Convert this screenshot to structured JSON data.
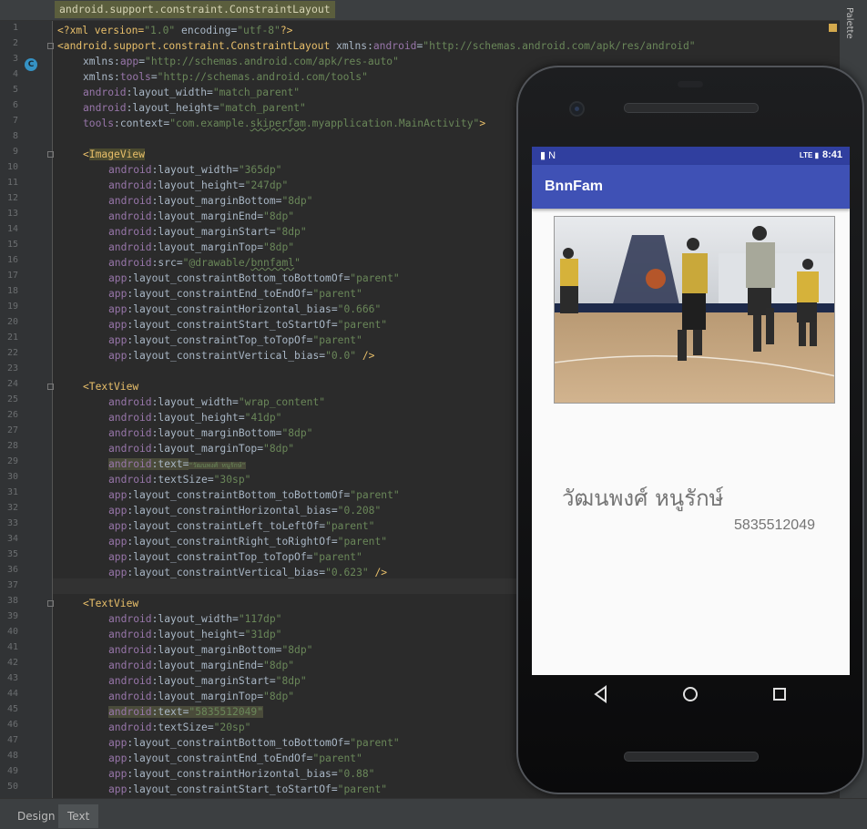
{
  "breadcrumb": "android.support.constraint.ConstraintLayout",
  "line_numbers": [
    "1",
    "2",
    "3",
    "4",
    "5",
    "6",
    "7",
    "8",
    "9",
    "10",
    "11",
    "12",
    "13",
    "14",
    "15",
    "16",
    "17",
    "18",
    "19",
    "20",
    "21",
    "22",
    "23",
    "24",
    "25",
    "26",
    "27",
    "28",
    "29",
    "30",
    "31",
    "32",
    "33",
    "34",
    "35",
    "36",
    "37",
    "38",
    "39",
    "40",
    "41",
    "42",
    "43",
    "44",
    "45",
    "46",
    "47",
    "48",
    "49",
    "50"
  ],
  "palette_tab": "Palette",
  "bottom_tabs": {
    "design": "Design",
    "text": "Text"
  },
  "gutter_badge": "C",
  "phone": {
    "status_time": "8:41",
    "status_left_icons": "▮ N",
    "status_right_icons": "LTE ▮",
    "app_title": "BnnFam",
    "name_text": "วัฒนพงศ์ หนูรักษ์",
    "id_text": "5835512049",
    "nav": [
      "back-icon",
      "home-icon",
      "recents-icon"
    ]
  },
  "code": {
    "l1": {
      "a": "<?xml version=",
      "b": "\"1.0\"",
      "c": " encoding=",
      "d": "\"utf-8\"",
      "e": "?>"
    },
    "l2": {
      "a": "<android.support.constraint.ConstraintLayout",
      "b": " xmlns:",
      "c": "android",
      "d": "=",
      "e": "\"http://schemas.android.com/apk/res/android\""
    },
    "l3": {
      "a": "xmlns:",
      "b": "app",
      "c": "=",
      "d": "\"http://schemas.android.com/apk/res-auto\""
    },
    "l4": {
      "a": "xmlns:",
      "b": "tools",
      "c": "=",
      "d": "\"http://schemas.android.com/tools\""
    },
    "l5": {
      "a": "android",
      "b": ":layout_width=",
      "c": "\"match_parent\""
    },
    "l6": {
      "a": "android",
      "b": ":layout_height=",
      "c": "\"match_parent\""
    },
    "l7": {
      "a": "tools",
      "b": ":context=",
      "c": "\"com.example.",
      "d": "skiperfam",
      "e": ".myapplication.MainActivity\"",
      "f": ">"
    },
    "l9": {
      "a": "<",
      "b": "ImageView"
    },
    "l10": {
      "a": "android",
      "b": ":layout_width=",
      "c": "\"365dp\""
    },
    "l11": {
      "a": "android",
      "b": ":layout_height=",
      "c": "\"247dp\""
    },
    "l12": {
      "a": "android",
      "b": ":layout_marginBottom=",
      "c": "\"8dp\""
    },
    "l13": {
      "a": "android",
      "b": ":layout_marginEnd=",
      "c": "\"8dp\""
    },
    "l14": {
      "a": "android",
      "b": ":layout_marginStart=",
      "c": "\"8dp\""
    },
    "l15": {
      "a": "android",
      "b": ":layout_marginTop=",
      "c": "\"8dp\""
    },
    "l16": {
      "a": "android",
      "b": ":src=",
      "c": "\"@drawable/",
      "d": "bnnfaml",
      "e": "\""
    },
    "l17": {
      "a": "app",
      "b": ":layout_constraintBottom_toBottomOf=",
      "c": "\"parent\""
    },
    "l18": {
      "a": "app",
      "b": ":layout_constraintEnd_toEndOf=",
      "c": "\"parent\""
    },
    "l19": {
      "a": "app",
      "b": ":layout_constraintHorizontal_bias=",
      "c": "\"0.666\""
    },
    "l20": {
      "a": "app",
      "b": ":layout_constraintStart_toStartOf=",
      "c": "\"parent\""
    },
    "l21": {
      "a": "app",
      "b": ":layout_constraintTop_toTopOf=",
      "c": "\"parent\""
    },
    "l22": {
      "a": "app",
      "b": ":layout_constraintVertical_bias=",
      "c": "\"0.0\"",
      "d": " />"
    },
    "l24": {
      "a": "<TextView"
    },
    "l25": {
      "a": "android",
      "b": ":layout_width=",
      "c": "\"wrap_content\""
    },
    "l26": {
      "a": "android",
      "b": ":layout_height=",
      "c": "\"41dp\""
    },
    "l27": {
      "a": "android",
      "b": ":layout_marginBottom=",
      "c": "\"8dp\""
    },
    "l28": {
      "a": "android",
      "b": ":layout_marginTop=",
      "c": "\"8dp\""
    },
    "l29": {
      "a": "android",
      "b": ":text=",
      "c": "\"วัฒนพงศ์ หนูรักษ์\""
    },
    "l30": {
      "a": "android",
      "b": ":textSize=",
      "c": "\"30sp\""
    },
    "l31": {
      "a": "app",
      "b": ":layout_constraintBottom_toBottomOf=",
      "c": "\"parent\""
    },
    "l32": {
      "a": "app",
      "b": ":layout_constraintHorizontal_bias=",
      "c": "\"0.208\""
    },
    "l33": {
      "a": "app",
      "b": ":layout_constraintLeft_toLeftOf=",
      "c": "\"parent\""
    },
    "l34": {
      "a": "app",
      "b": ":layout_constraintRight_toRightOf=",
      "c": "\"parent\""
    },
    "l35": {
      "a": "app",
      "b": ":layout_constraintTop_toTopOf=",
      "c": "\"parent\""
    },
    "l36": {
      "a": "app",
      "b": ":layout_constraintVertical_bias=",
      "c": "\"0.623\"",
      "d": " />"
    },
    "l38": {
      "a": "<TextView"
    },
    "l39": {
      "a": "android",
      "b": ":layout_width=",
      "c": "\"117dp\""
    },
    "l40": {
      "a": "android",
      "b": ":layout_height=",
      "c": "\"31dp\""
    },
    "l41": {
      "a": "android",
      "b": ":layout_marginBottom=",
      "c": "\"8dp\""
    },
    "l42": {
      "a": "android",
      "b": ":layout_marginEnd=",
      "c": "\"8dp\""
    },
    "l43": {
      "a": "android",
      "b": ":layout_marginStart=",
      "c": "\"8dp\""
    },
    "l44": {
      "a": "android",
      "b": ":layout_marginTop=",
      "c": "\"8dp\""
    },
    "l45": {
      "a": "android",
      "b": ":text=",
      "c": "\"5835512049\""
    },
    "l46": {
      "a": "android",
      "b": ":textSize=",
      "c": "\"20sp\""
    },
    "l47": {
      "a": "app",
      "b": ":layout_constraintBottom_toBottomOf=",
      "c": "\"parent\""
    },
    "l48": {
      "a": "app",
      "b": ":layout_constraintEnd_toEndOf=",
      "c": "\"parent\""
    },
    "l49": {
      "a": "app",
      "b": ":layout_constraintHorizontal_bias=",
      "c": "\"0.88\""
    },
    "l50": {
      "a": "app",
      "b": ":layout_constraintStart_toStartOf=",
      "c": "\"parent\""
    }
  },
  "colors": {
    "editor_bg": "#2b2b2b",
    "tag": "#e8bf6a",
    "attr_ns": "#9876aa",
    "string": "#6a8759",
    "app_bar": "#3f51b5",
    "status_bar": "#303f9f"
  }
}
